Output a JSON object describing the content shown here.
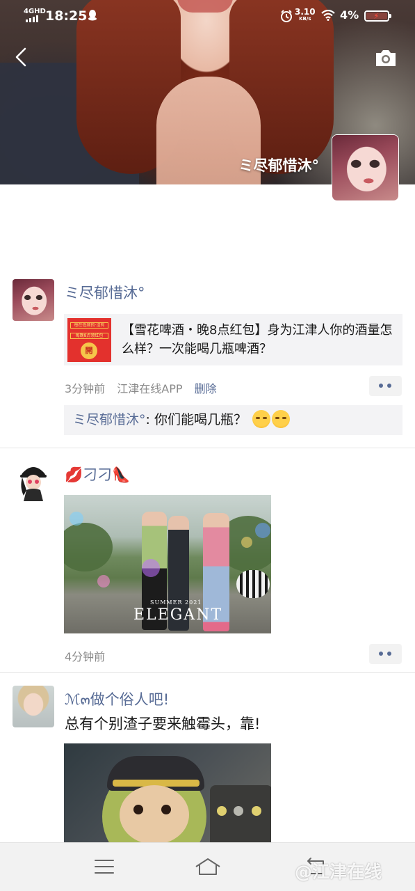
{
  "status_bar": {
    "network": "4GHD",
    "time": "18:25",
    "speed": "3.10",
    "speed_unit": "KB/s",
    "battery": "4%"
  },
  "cover": {
    "user_name": "ミ尽郁惜沐°"
  },
  "posts": [
    {
      "name": "ミ尽郁惜沐°",
      "share": {
        "thumb_line1": "每在低频的·沒有",
        "thumb_line2": "每晚8点领红包",
        "thumb_open": "開",
        "title": "【雪花啤酒・晚8点红包】身为江津人你的酒量怎么样？一次能喝几瓶啤酒？"
      },
      "time": "3分钟前",
      "source": "江津在线APP",
      "delete_label": "删除",
      "comment": {
        "author": "ミ尽郁惜沐°",
        "text": ": 你们能喝几瓶？"
      }
    },
    {
      "name": "💋刁刁👠",
      "photo_caption": "ELEGANT",
      "photo_caption_small": "SUMMER 2021",
      "time": "4分钟前"
    },
    {
      "name": "ℳ๓做个俗人吧!",
      "text": "总有个别渣子要来触霉头，靠!"
    }
  ],
  "watermark": "@江津在线",
  "icons": {
    "back": "chevron-left-icon",
    "camera": "camera-icon",
    "more": "more-dots-icon",
    "nav": [
      "menu-icon",
      "home-icon",
      "back-return-icon"
    ]
  },
  "colors": {
    "link": "#576b95",
    "text": "#191919",
    "meta": "#8a8a8a",
    "card_bg": "#f3f3f5"
  }
}
